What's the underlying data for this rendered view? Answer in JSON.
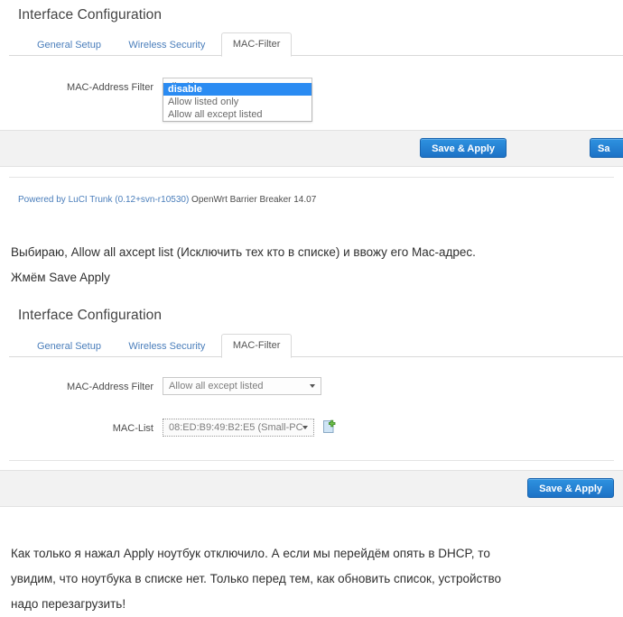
{
  "panel1": {
    "title": "Interface Configuration",
    "tabs": [
      {
        "label": "General Setup",
        "active": false
      },
      {
        "label": "Wireless Security",
        "active": false
      },
      {
        "label": "MAC-Filter",
        "active": true
      }
    ],
    "filter_row": {
      "label": "MAC-Address Filter",
      "value": "disable"
    },
    "dropdown_open": true,
    "dropdown_options": [
      {
        "label": "disable",
        "selected": true
      },
      {
        "label": "Allow listed only",
        "selected": false
      },
      {
        "label": "Allow all except listed",
        "selected": false
      }
    ],
    "buttons": [
      {
        "label": "Save & Apply"
      },
      {
        "label": "Sa"
      }
    ],
    "credit_link": "Powered by LuCI Trunk (0.12+svn-r10530)",
    "credit_text": " OpenWrt Barrier Breaker 14.07"
  },
  "note1": {
    "line1": "Выбираю, Allow all axcept list (Исключить тех кто в списке) и ввожу его Mac-адрес.",
    "line2": "Жмём Save Apply"
  },
  "panel2": {
    "title": "Interface Configuration",
    "tabs": [
      {
        "label": "General Setup",
        "active": false
      },
      {
        "label": "Wireless Security",
        "active": false
      },
      {
        "label": "MAC-Filter",
        "active": true
      }
    ],
    "filter_row": {
      "label": "MAC-Address Filter",
      "value": "Allow all except listed"
    },
    "maclist_row": {
      "label": "MAC-List",
      "value": "08:ED:B9:49:B2:E5 (Small-PC-",
      "add_icon": "add-document-icon"
    },
    "buttons": [
      {
        "label": "Save & Apply"
      }
    ]
  },
  "note2": {
    "line1": "Как только я нажал Apply ноутбук отключило. А если мы перейдём опять в DHCP, то",
    "line2": "увидим, что ноутбука в списке нет. Только перед тем, как обновить список, устройство",
    "line3": "надо перезагрузить!"
  },
  "colors": {
    "accent_link": "#4a7ebb",
    "button_blue": "#1d72c6",
    "dropdown_highlight": "#2a8bf2",
    "panel_gray": "#f2f2f2"
  }
}
